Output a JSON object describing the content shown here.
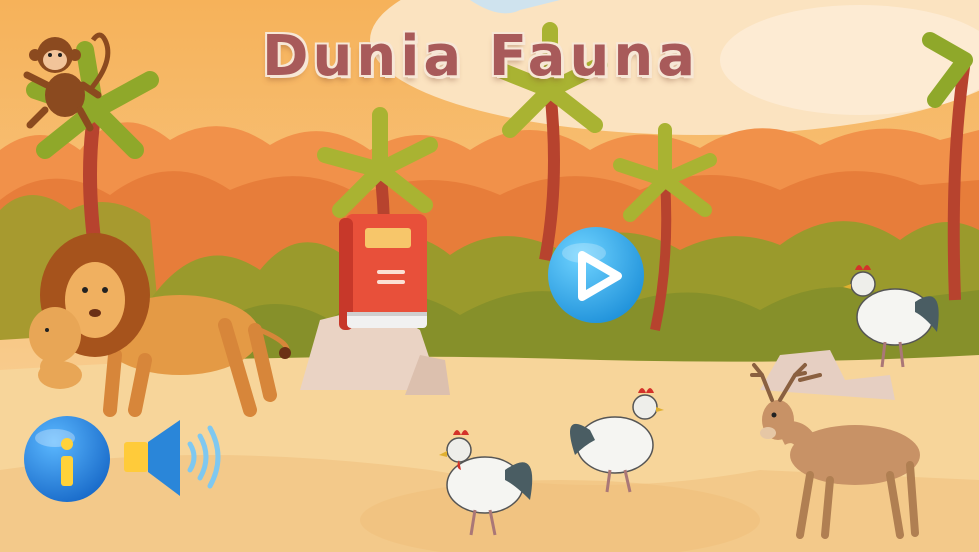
{
  "app": {
    "title": "Dunia Fauna"
  },
  "buttons": {
    "book_icon": "book-icon",
    "play_icon": "play-icon",
    "info_icon": "info-icon",
    "sound_icon": "speaker-icon",
    "info_glyph": "i"
  },
  "colors": {
    "title": "#a85a5a",
    "play": "#2aa3e6",
    "info": "#1f7fd8",
    "info_glyph": "#ffd23a",
    "book": "#e8503a",
    "sound": "#2a86d9"
  }
}
